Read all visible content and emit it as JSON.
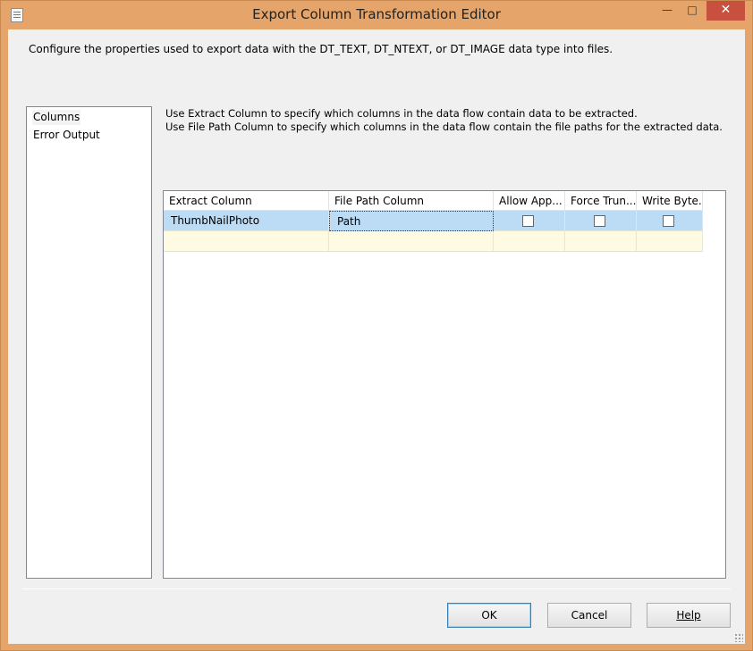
{
  "window": {
    "title": "Export Column Transformation Editor",
    "minimize_glyph": "—",
    "maximize_glyph": "□",
    "close_glyph": "✕"
  },
  "description": "Configure the properties used to export data with the DT_TEXT, DT_NTEXT, or DT_IMAGE data type into files.",
  "nav": {
    "items": [
      {
        "label": "Columns",
        "selected": true
      },
      {
        "label": "Error Output",
        "selected": false
      }
    ]
  },
  "instructions": {
    "line1": "Use Extract Column to specify which columns in the data flow contain data to be extracted.",
    "line2": "Use File Path Column to specify which columns in the data flow contain the file paths for the extracted data."
  },
  "grid": {
    "headers": [
      "Extract Column",
      "File Path Column",
      "Allow App...",
      "Force Trun...",
      "Write Byte..."
    ],
    "rows": [
      {
        "extract_column": "ThumbNailPhoto",
        "file_path_column": "Path",
        "allow_append": false,
        "force_truncate": false,
        "write_bom": false
      },
      {
        "extract_column": "",
        "file_path_column": "",
        "new_row": true
      }
    ]
  },
  "buttons": {
    "ok": "OK",
    "cancel": "Cancel",
    "help": "Help"
  },
  "colors": {
    "window_frame": "#e4a46a",
    "close_button": "#c7503e",
    "selected_row": "#bcdcf6",
    "new_row": "#fffbe3"
  }
}
